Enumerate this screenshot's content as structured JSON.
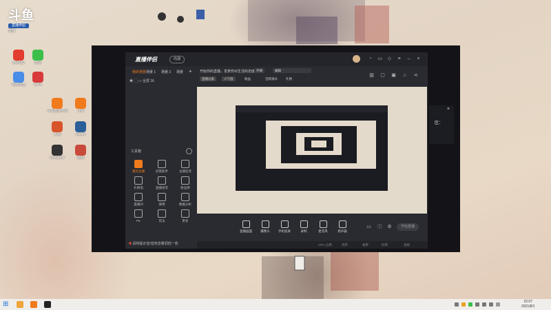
{
  "wallpaper": {
    "logo_mark": "斗鱼",
    "logo_tag": "直播伴侣",
    "logo_sub": "直播"
  },
  "desktop_icons": [
    {
      "label": "腾讯QQ",
      "color": "#e23b2f"
    },
    {
      "label": "微信",
      "color": "#3bbf4a"
    },
    {
      "label": "百度网盘",
      "color": "#4a8de8"
    },
    {
      "label": "WPS",
      "color": "#d83a3a"
    },
    {
      "label": "斗鱼直播伴侣",
      "color": "#f07a1c"
    },
    {
      "label": "斗鱼",
      "color": "#f07a1c"
    },
    {
      "label": "火绒",
      "color": "#d8552b"
    },
    {
      "label": "Steam",
      "color": "#2b5f9a"
    },
    {
      "label": "WeGame",
      "color": "#333333"
    },
    {
      "label": "游戏",
      "color": "#c94a3a"
    }
  ],
  "app": {
    "brand": "直播伴侣",
    "version_badge": "内测",
    "left_tabs": [
      "我的场景",
      "场景 1",
      "场景 2",
      "场景"
    ],
    "scene_source": "全屏 36",
    "tools_title": "工具箱",
    "tools": [
      {
        "label": "我的主播"
      },
      {
        "label": "房管助手"
      },
      {
        "label": "主播任务"
      },
      {
        "label": "礼物墙"
      },
      {
        "label": "直播语音"
      },
      {
        "label": "粉丝牌"
      },
      {
        "label": "直播间"
      },
      {
        "label": "微博"
      },
      {
        "label": "数据分析"
      },
      {
        "label": "PK"
      },
      {
        "label": "玩法"
      },
      {
        "label": "更多"
      }
    ],
    "notice": "请将提示音/音效音量调低一些",
    "title_input": "开始你的直播，发表你对生活的态度",
    "title_button": "开播",
    "edit_label": "编辑",
    "info_pills": [
      "直播分类",
      "人气值",
      "收益",
      "活跃观众",
      "礼物"
    ],
    "bottom_items": [
      {
        "label": "直播画面"
      },
      {
        "label": "摄像头"
      },
      {
        "label": "手机投屏"
      },
      {
        "label": "录制"
      },
      {
        "label": "麦克风"
      },
      {
        "label": "扬声器"
      }
    ],
    "go_live": "开始直播",
    "status_items": [
      "CPU 占用",
      "内存",
      "帧率",
      "码率",
      "丢帧"
    ]
  },
  "popup": {
    "title": "区："
  },
  "taskbar": {
    "time": "22:07",
    "date": "2021/8/1"
  }
}
